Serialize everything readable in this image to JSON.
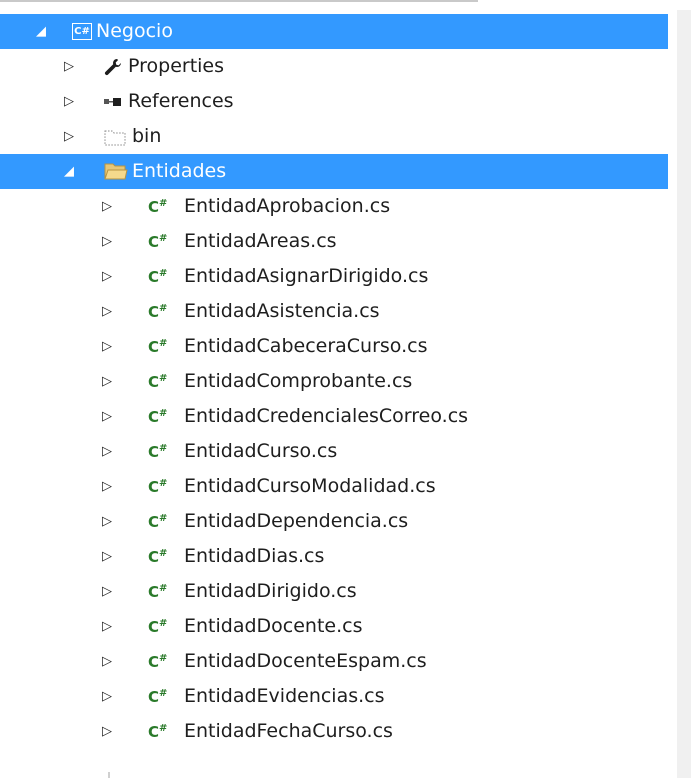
{
  "tree": {
    "project": {
      "label": "Negocio",
      "icon": "csharp-project-icon"
    },
    "properties": {
      "label": "Properties",
      "icon": "wrench-icon"
    },
    "references": {
      "label": "References",
      "icon": "references-icon"
    },
    "bin": {
      "label": "bin",
      "icon": "hidden-folder-icon"
    },
    "entidades": {
      "label": "Entidades",
      "icon": "folder-open-icon"
    },
    "files": [
      "EntidadAprobacion.cs",
      "EntidadAreas.cs",
      "EntidadAsignarDirigido.cs",
      "EntidadAsistencia.cs",
      "EntidadCabeceraCurso.cs",
      "EntidadComprobante.cs",
      "EntidadCredencialesCorreo.cs",
      "EntidadCurso.cs",
      "EntidadCursoModalidad.cs",
      "EntidadDependencia.cs",
      "EntidadDias.cs",
      "EntidadDirigido.cs",
      "EntidadDocente.cs",
      "EntidadDocenteEspam.cs",
      "EntidadEvidencias.cs",
      "EntidadFechaCurso.cs"
    ]
  },
  "colors": {
    "selection": "#3399ff",
    "cs_file": "#2a7a2a"
  }
}
